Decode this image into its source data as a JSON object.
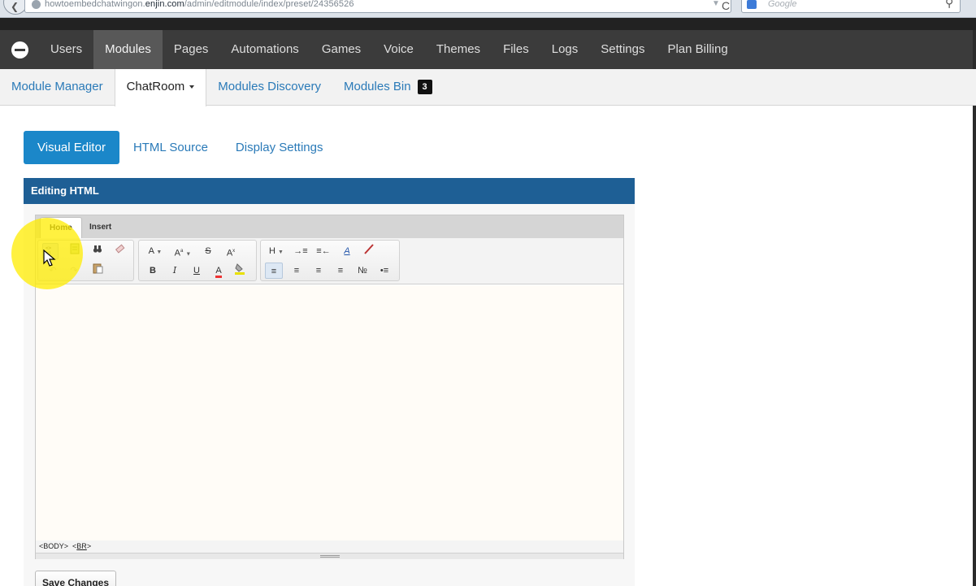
{
  "browser": {
    "url_prefix": "howtoembedchatwingon.",
    "url_domain": "enjin.com",
    "url_path": "/admin/editmodule/index/preset/24356526",
    "search_placeholder": "Google"
  },
  "main_nav": {
    "items": [
      {
        "label": "Users"
      },
      {
        "label": "Modules",
        "active": true
      },
      {
        "label": "Pages"
      },
      {
        "label": "Automations"
      },
      {
        "label": "Games"
      },
      {
        "label": "Voice"
      },
      {
        "label": "Themes"
      },
      {
        "label": "Files"
      },
      {
        "label": "Logs"
      },
      {
        "label": "Settings"
      },
      {
        "label": "Plan Billing"
      }
    ]
  },
  "sub_nav": {
    "module_manager": "Module Manager",
    "chatroom": "ChatRoom",
    "modules_discovery": "Modules Discovery",
    "modules_bin": "Modules Bin",
    "modules_bin_count": "3"
  },
  "editor_tabs": {
    "visual": "Visual Editor",
    "html_source": "HTML Source",
    "display_settings": "Display Settings"
  },
  "panel": {
    "title": "Editing HTML"
  },
  "ribbon": {
    "tab_home": "Home",
    "tab_insert": "Insert"
  },
  "status": {
    "body_tag": "<BODY>",
    "br_tag": "BR"
  },
  "save_label": "Save Changes",
  "colors": {
    "nav_bg": "#3b3b3b",
    "accent_blue": "#1b87c9",
    "panel_header": "#1e5f95",
    "link": "#2a7ab8"
  }
}
